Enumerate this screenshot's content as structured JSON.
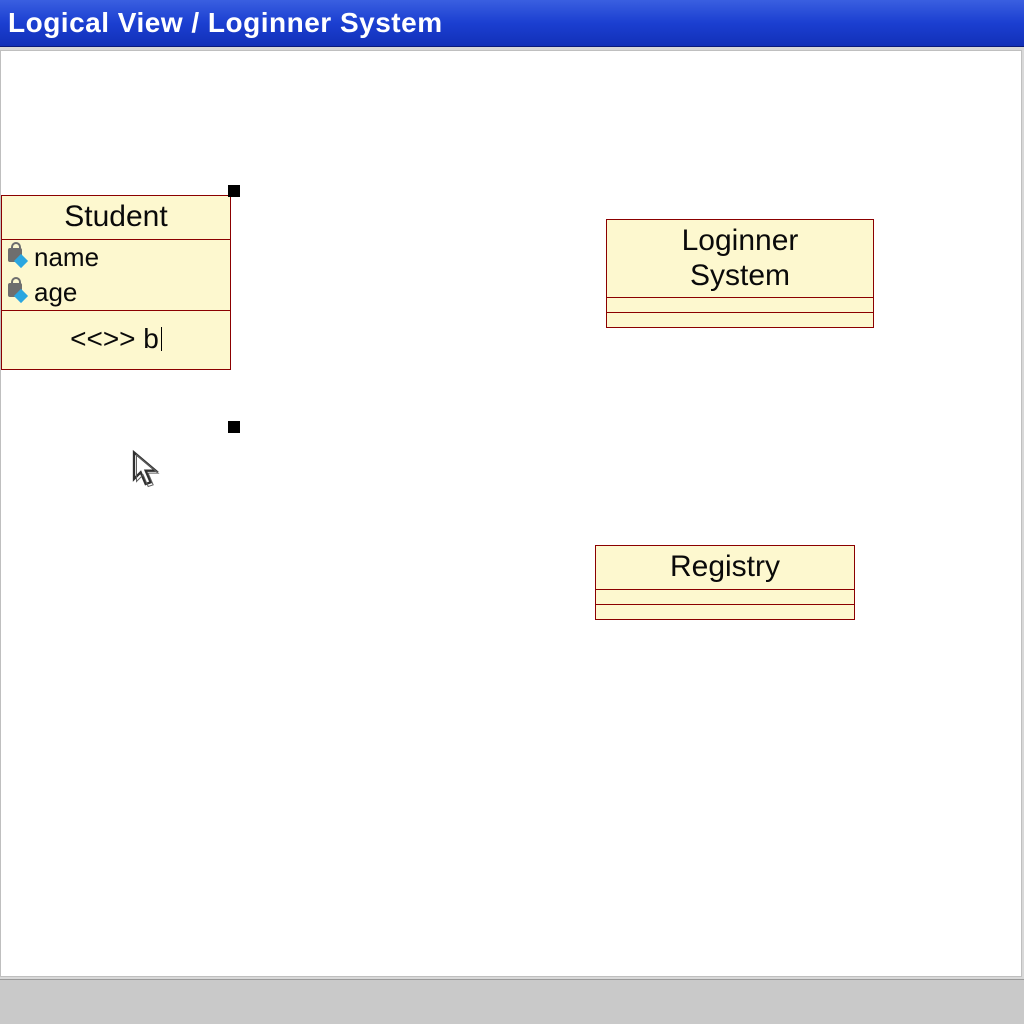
{
  "window": {
    "title": "Logical View / Loginner System"
  },
  "classes": {
    "student": {
      "name": "Student",
      "attributes": [
        {
          "name": "name"
        },
        {
          "name": "age"
        }
      ],
      "operation_editing": "<<>> b",
      "selected": true
    },
    "loginner": {
      "name_line1": "Loginner",
      "name_line2": "System"
    },
    "registry": {
      "name": "Registry"
    }
  }
}
